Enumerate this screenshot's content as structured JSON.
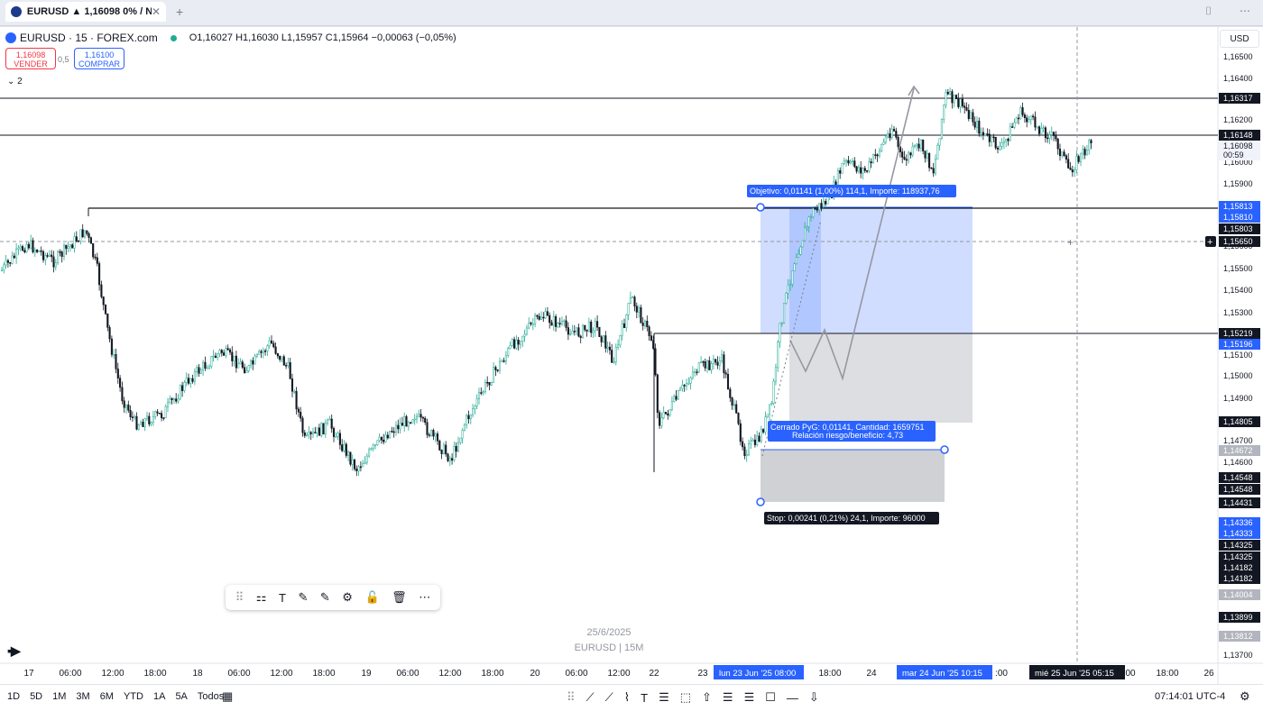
{
  "browser": {
    "tab_title": "EURUSD ▲ 1,16098 0% / N",
    "close": "✕",
    "new_tab": "+",
    "right_icons": [
      "⌷",
      "⋯"
    ]
  },
  "header": {
    "symbol": "EURUSD · 15 · FOREX.com",
    "ohlc": "O1,16027 H1,16030 L1,15957 C1,15964 −0,00063 (−0,05%)",
    "sell_price": "1,16098",
    "sell_label": "VENDER",
    "spread": "0,5",
    "buy_price": "1,16100",
    "buy_label": "COMPRAR",
    "indicators_collapsed": "⌄ 2",
    "currency": "USD"
  },
  "colors": {
    "up": "#22ab94",
    "price_line": "#131722",
    "target": "#2962ff",
    "stop": "#9598a1",
    "label_dark": "#131722"
  },
  "price_axis": {
    "ticks": [
      "1,16500",
      "1,16400",
      "1,16200",
      "1,16000",
      "1,15900",
      "1,15600",
      "1,15500",
      "1,15400",
      "1,15300",
      "1,15100",
      "1,15000",
      "1,14900",
      "1,14700",
      "1,14600",
      "1,13700"
    ],
    "labels": [
      {
        "v": "1,16317",
        "s": "dark"
      },
      {
        "v": "1,16148",
        "s": "dark"
      },
      {
        "v": "1,16098",
        "s": "light"
      },
      {
        "v": "00:59",
        "s": "light"
      },
      {
        "v": "1,15813",
        "s": "blue"
      },
      {
        "v": "1,15810",
        "s": "blue"
      },
      {
        "v": "1,15803",
        "s": "dark"
      },
      {
        "v": "1,15650",
        "s": "dark"
      },
      {
        "v": "1,15219",
        "s": "dark"
      },
      {
        "v": "1,15196",
        "s": "blue"
      },
      {
        "v": "1,14805",
        "s": "dark"
      },
      {
        "v": "1,14672",
        "s": "grey"
      },
      {
        "v": "1,14548",
        "s": "dark"
      },
      {
        "v": "1,14548",
        "s": "dark"
      },
      {
        "v": "1,14431",
        "s": "dark"
      },
      {
        "v": "1,14336",
        "s": "blue"
      },
      {
        "v": "1,14333",
        "s": "blue"
      },
      {
        "v": "1,14325",
        "s": "dark"
      },
      {
        "v": "1,14325",
        "s": "dark"
      },
      {
        "v": "1,14182",
        "s": "dark"
      },
      {
        "v": "1,14182",
        "s": "dark"
      },
      {
        "v": "1,14004",
        "s": "grey"
      },
      {
        "v": "1,13899",
        "s": "dark"
      },
      {
        "v": "1,13812",
        "s": "grey"
      }
    ]
  },
  "time_axis": {
    "ticks": [
      "17",
      "06:00",
      "12:00",
      "18:00",
      "18",
      "06:00",
      "12:00",
      "18:00",
      "19",
      "06:00",
      "12:00",
      "18:00",
      "20",
      "06:00",
      "12:00",
      "22",
      "23",
      "18:00",
      "24",
      ":00",
      "00",
      "18:00",
      "26"
    ],
    "highlights": [
      "lun 23 Jun '25   08:00",
      "mar 24 Jun '25   10:15",
      "mié 25 Jun '25   05:15"
    ]
  },
  "position": {
    "target_label": "Objetivo: 0,01141 (1,00%) 114,1, Importe: 118937,76",
    "closed_label": "Cerrado PyG: 0,01141, Cantidad: 1659751",
    "rr_label": "Relación riesgo/beneficio: 4,73",
    "stop_label": "Stop: 0,00241 (0,21%) 24,1, Importe: 96000"
  },
  "watermark": {
    "date": "25/6/2025",
    "symbol": "EURUSD | 15M"
  },
  "draw_toolbar": {
    "icons": [
      "⠿",
      "⚏",
      "T",
      "✎",
      "✎",
      "⚙",
      "🔓",
      "🗑",
      "⋯"
    ]
  },
  "bottom": {
    "ranges": [
      "1D",
      "5D",
      "1M",
      "3M",
      "6M",
      "YTD",
      "1A",
      "5A",
      "Todos"
    ],
    "range_icon": "▦",
    "tools": [
      "⠿",
      "⟋",
      "⟋",
      "⌇",
      "T",
      "☰",
      "⬚",
      "⇧",
      "☰",
      "☰",
      "☐",
      "—",
      "⇩"
    ],
    "clock": "07:14:01 UTC-4",
    "settings": "⚙"
  }
}
